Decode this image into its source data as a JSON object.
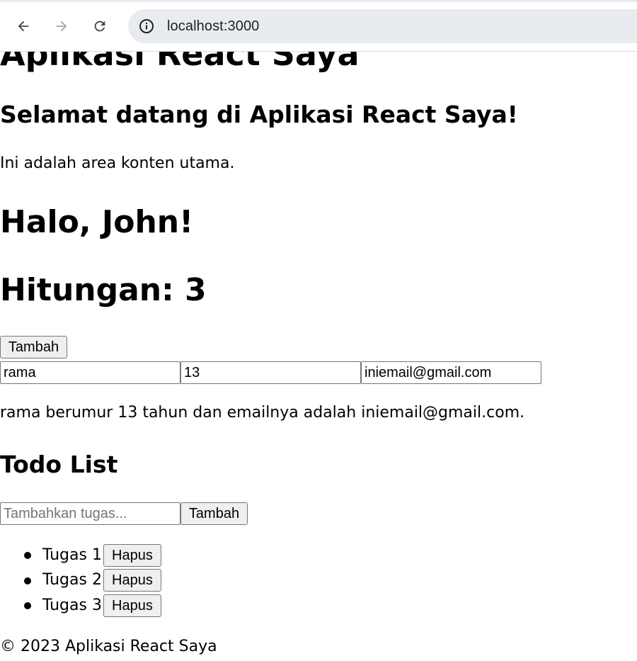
{
  "browser": {
    "url": "localhost:3000",
    "back_icon": "arrow-left-icon",
    "forward_icon": "arrow-right-icon",
    "reload_icon": "reload-icon",
    "info_icon": "info-icon"
  },
  "app": {
    "title": "Aplikasi React Saya",
    "welcome": "Selamat datang di Aplikasi React Saya!",
    "main_text": "Ini adalah area konten utama.",
    "greeting": "Halo, John!"
  },
  "counter": {
    "label": "Hitungan: 3",
    "button_label": "Tambah"
  },
  "form": {
    "name_value": "rama",
    "age_value": "13",
    "email_value": "iniemail@gmail.com",
    "summary": "rama berumur 13 tahun dan emailnya adalah iniemail@gmail.com."
  },
  "todo": {
    "title": "Todo List",
    "input_placeholder": "Tambahkan tugas...",
    "add_button": "Tambah",
    "items": [
      {
        "text": "Tugas 1",
        "delete_label": "Hapus"
      },
      {
        "text": "Tugas 2",
        "delete_label": "Hapus"
      },
      {
        "text": "Tugas 3",
        "delete_label": "Hapus"
      }
    ]
  },
  "footer": {
    "text": "© 2023 Aplikasi React Saya"
  },
  "colors": {
    "omnibox_bg": "#e8ebf0",
    "button_bg": "#efefef",
    "input_border": "#767676"
  }
}
